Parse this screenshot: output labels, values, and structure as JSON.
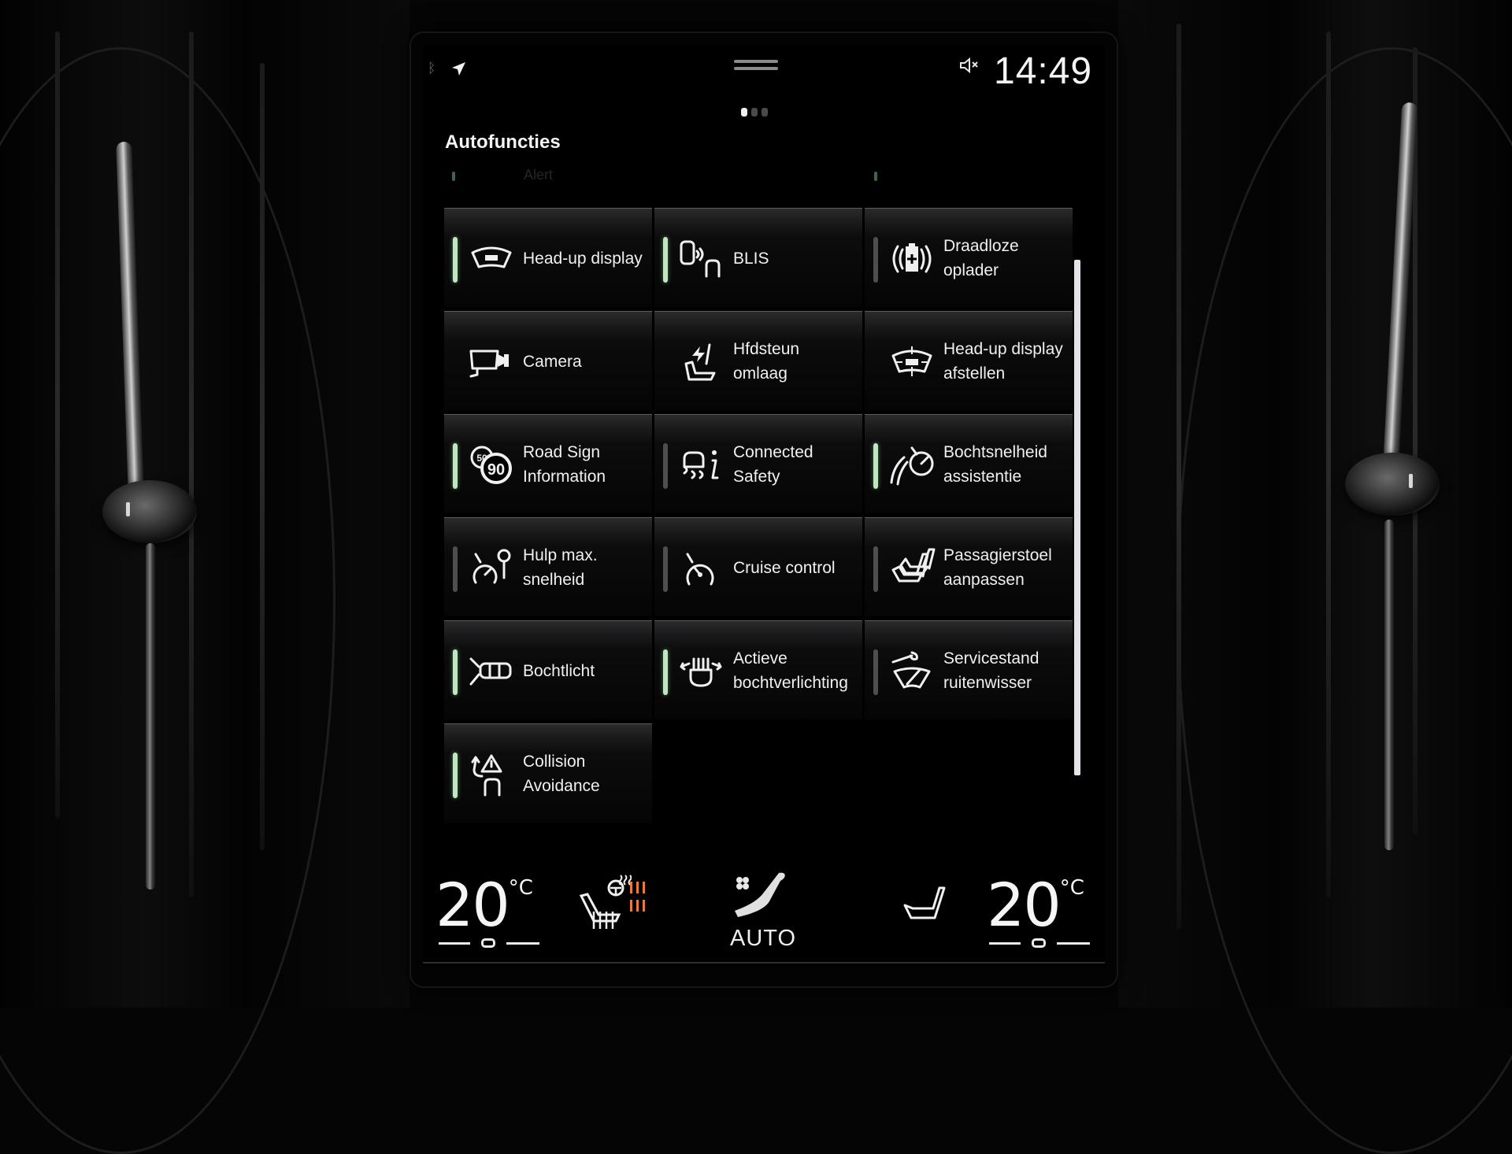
{
  "status_bar": {
    "bluetooth_icon": "bluetooth-icon",
    "navigation_icon": "navigation-arrow-icon",
    "handle_icon": "pull-down-handle-icon",
    "mute_icon": "speaker-muted-icon",
    "time": "14:49",
    "page_indicator": {
      "pages": 3,
      "active_page": 1
    }
  },
  "page": {
    "title": "Autofuncties",
    "scrolled_partial_item": "Alert"
  },
  "colors": {
    "indicator_on": "#bfe8c0",
    "indicator_off": "#4e4e4e",
    "seat_heat_level": "#e87b3d",
    "text": "#f0f0f0",
    "background": "#000000"
  },
  "functions": [
    {
      "label_line1": "Head-up display",
      "label_line2": "",
      "icon": "head-up-display-icon",
      "indicator": true,
      "state": "on"
    },
    {
      "label_line1": "BLIS",
      "label_line2": "",
      "icon": "blind-spot-icon",
      "indicator": true,
      "state": "on"
    },
    {
      "label_line1": "Draadloze",
      "label_line2": "oplader",
      "icon": "wireless-charger-icon",
      "indicator": true,
      "state": "off"
    },
    {
      "label_line1": "Camera",
      "label_line2": "",
      "icon": "camera-icon",
      "indicator": false,
      "state": "none"
    },
    {
      "label_line1": "Hfdsteun",
      "label_line2": "omlaag",
      "icon": "headrest-down-icon",
      "indicator": false,
      "state": "none"
    },
    {
      "label_line1": "Head-up display",
      "label_line2": "afstellen",
      "icon": "head-up-display-adjust-icon",
      "indicator": false,
      "state": "none"
    },
    {
      "label_line1": "Road Sign",
      "label_line2": "Information",
      "icon": "road-sign-icon",
      "indicator": true,
      "state": "on"
    },
    {
      "label_line1": "Connected",
      "label_line2": "Safety",
      "icon": "connected-safety-icon",
      "indicator": true,
      "state": "off"
    },
    {
      "label_line1": "Bochtsnelheid",
      "label_line2": "assistentie",
      "icon": "curve-speed-icon",
      "indicator": true,
      "state": "on"
    },
    {
      "label_line1": "Hulp max.",
      "label_line2": "snelheid",
      "icon": "speed-limiter-icon",
      "indicator": true,
      "state": "off"
    },
    {
      "label_line1": "Cruise control",
      "label_line2": "",
      "icon": "cruise-control-icon",
      "indicator": true,
      "state": "off"
    },
    {
      "label_line1": "Passagierstoel",
      "label_line2": "aanpassen",
      "icon": "passenger-seat-icon",
      "indicator": true,
      "state": "off"
    },
    {
      "label_line1": "Bochtlicht",
      "label_line2": "",
      "icon": "cornering-light-icon",
      "indicator": true,
      "state": "on"
    },
    {
      "label_line1": "Actieve",
      "label_line2": "bochtverlichting",
      "icon": "active-bending-light-icon",
      "indicator": true,
      "state": "on"
    },
    {
      "label_line1": "Servicestand",
      "label_line2": "ruitenwisser",
      "icon": "wiper-service-icon",
      "indicator": true,
      "state": "off"
    },
    {
      "label_line1": "Collision",
      "label_line2": "Avoidance",
      "icon": "collision-avoidance-icon",
      "indicator": true,
      "state": "on"
    }
  ],
  "climate": {
    "driver_temp": "20",
    "passenger_temp": "20",
    "temp_unit": "°C",
    "driver_seat_icon": "heated-seat-steering-icon",
    "seat_heat_level": 3,
    "steering_heat_level": 3,
    "fan_icon": "fan-airflow-icon",
    "fan_mode": "AUTO",
    "passenger_seat_icon": "passenger-seat-climate-icon"
  }
}
